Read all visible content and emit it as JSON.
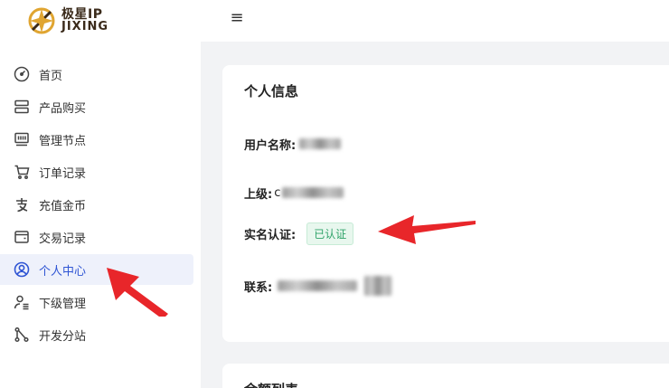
{
  "header": {
    "brand_cn": "极星IP",
    "brand_en": "JIXING",
    "menu_toggle": "≡"
  },
  "sidebar": {
    "items": [
      {
        "label": "首页",
        "icon": "dashboard-icon"
      },
      {
        "label": "产品购买",
        "icon": "server-icon"
      },
      {
        "label": "管理节点",
        "icon": "nodes-icon"
      },
      {
        "label": "订单记录",
        "icon": "cart-icon"
      },
      {
        "label": "充值金币",
        "icon": "alipay-icon"
      },
      {
        "label": "交易记录",
        "icon": "wallet-icon"
      },
      {
        "label": "个人中心",
        "icon": "user-circle-icon",
        "active": true
      },
      {
        "label": "下级管理",
        "icon": "user-manage-icon"
      },
      {
        "label": "开发分站",
        "icon": "branch-icon"
      }
    ]
  },
  "profile": {
    "title": "个人信息",
    "username_label": "用户名称:",
    "parent_label": "上级:",
    "parent_value_visible": "c",
    "realname_label": "实名认证:",
    "realname_status": "已认证",
    "contact_label": "联系:"
  },
  "next_card": {
    "title": "余额列表"
  },
  "colors": {
    "accent": "#2f55d4",
    "success": "#2fa36a",
    "arrow": "#e8262a"
  }
}
